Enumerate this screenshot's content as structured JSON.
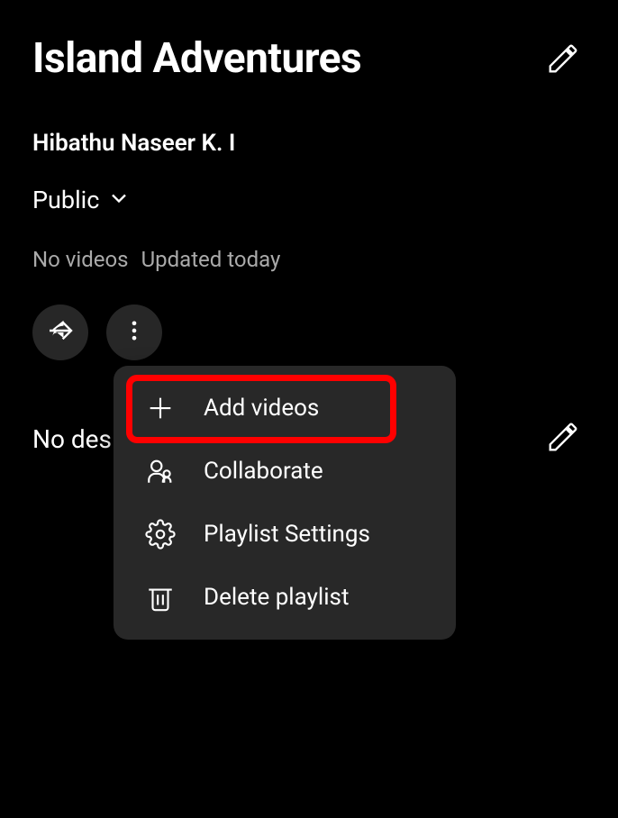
{
  "playlist": {
    "title": "Island Adventures",
    "author": "Hibathu Naseer K. I",
    "visibility": "Public",
    "video_count": "No videos",
    "updated": "Updated today",
    "description": "No des"
  },
  "menu": {
    "items": [
      {
        "icon": "plus-icon",
        "label": "Add videos"
      },
      {
        "icon": "collaborate-icon",
        "label": "Collaborate"
      },
      {
        "icon": "gear-icon",
        "label": "Playlist Settings"
      },
      {
        "icon": "trash-icon",
        "label": "Delete playlist"
      }
    ]
  }
}
